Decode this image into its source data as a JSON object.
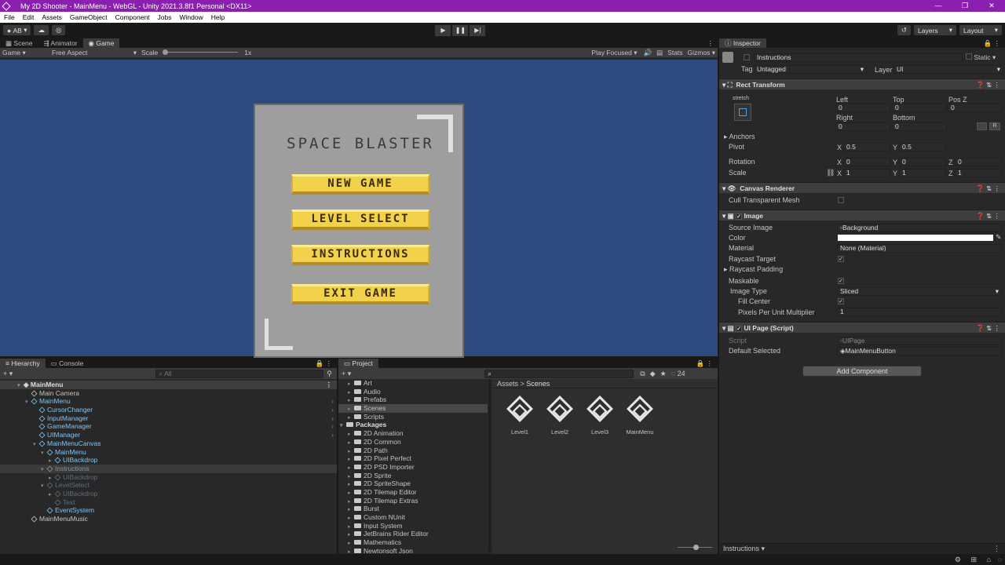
{
  "window": {
    "title": "My 2D Shooter - MainMenu - WebGL - Unity 2021.3.8f1 Personal <DX11>",
    "controls": [
      "—",
      "❐",
      "✕"
    ]
  },
  "menu": [
    "File",
    "Edit",
    "Assets",
    "GameObject",
    "Component",
    "Jobs",
    "Window",
    "Help"
  ],
  "toolbar": {
    "account": "AB",
    "layers": "Layers",
    "layout": "Layout"
  },
  "top_tabs": [
    "Scene",
    "Animator",
    "Game"
  ],
  "gamebar": {
    "display": "Game",
    "aspect": "Free Aspect",
    "scale_label": "Scale",
    "scale_value": "1x",
    "play_mode": "Play Focused",
    "stats": "Stats",
    "gizmos": "Gizmos"
  },
  "game": {
    "title": "SPACE BLASTER",
    "buttons": [
      "NEW GAME",
      "LEVEL SELECT",
      "INSTRUCTIONS",
      "EXIT GAME"
    ]
  },
  "hierarchy": {
    "tabs": [
      "Hierarchy",
      "Console"
    ],
    "search_placeholder": "All",
    "rows": [
      "MainMenu",
      "Main Camera",
      "MainMenu",
      "CursorChanger",
      "InputManager",
      "GameManager",
      "UIManager",
      "MainMenuCanvas",
      "MainMenu",
      "UIBackdrop",
      "Instructions",
      "UIBackdrop",
      "LevelSelect",
      "UIBackdrop",
      "Text",
      "EventSystem",
      "MainMenuMusic"
    ]
  },
  "project": {
    "tab": "Project",
    "hidden_count": "24",
    "breadcrumb": [
      "Assets",
      "Scenes"
    ],
    "tree": [
      "Art",
      "Audio",
      "Prefabs",
      "Scenes",
      "Scripts",
      "Packages",
      "2D Animation",
      "2D Common",
      "2D Path",
      "2D Pixel Perfect",
      "2D PSD Importer",
      "2D Sprite",
      "2D SpriteShape",
      "2D Tilemap Editor",
      "2D Tilemap Extras",
      "Burst",
      "Custom NUnit",
      "Input System",
      "JetBrains Rider Editor",
      "Mathematics",
      "Newtonsoft Json"
    ],
    "assets": [
      "Level1",
      "Level2",
      "Level3",
      "MainMenu"
    ]
  },
  "inspector": {
    "tab": "Inspector",
    "name": "Instructions",
    "static": "Static",
    "tag_label": "Tag",
    "tag": "Untagged",
    "layer_label": "Layer",
    "layer": "UI",
    "rect": {
      "title": "Rect Transform",
      "stretch": "stretch",
      "left_label": "Left",
      "top_label": "Top",
      "posz_label": "Pos Z",
      "left": "0",
      "top": "0",
      "posz": "0",
      "right_label": "Right",
      "bottom_label": "Bottom",
      "right": "0",
      "bottom": "0",
      "anchors": "Anchors",
      "pivot": "Pivot",
      "pivot_x": "0.5",
      "pivot_y": "0.5",
      "rotation": "Rotation",
      "rot_x": "0",
      "rot_y": "0",
      "rot_z": "0",
      "scale": "Scale",
      "scale_x": "1",
      "scale_y": "1",
      "scale_z": "1",
      "btn_r": "R"
    },
    "canvas_renderer": {
      "title": "Canvas Renderer",
      "cull": "Cull Transparent Mesh"
    },
    "image": {
      "title": "Image",
      "source_label": "Source Image",
      "source": "Background",
      "color_label": "Color",
      "color": "#ffffff",
      "material_label": "Material",
      "material": "None (Material)",
      "raycast_target": "Raycast Target",
      "raycast_padding": "Raycast Padding",
      "maskable": "Maskable",
      "image_type_label": "Image Type",
      "image_type": "Sliced",
      "fill_center": "Fill Center",
      "ppu_label": "Pixels Per Unit Multiplier",
      "ppu": "1"
    },
    "uipage": {
      "title": "UI Page (Script)",
      "script_label": "Script",
      "script": "UIPage",
      "default_label": "Default Selected",
      "default": "MainMenuButton"
    },
    "add_component": "Add Component",
    "footer": "Instructions"
  }
}
